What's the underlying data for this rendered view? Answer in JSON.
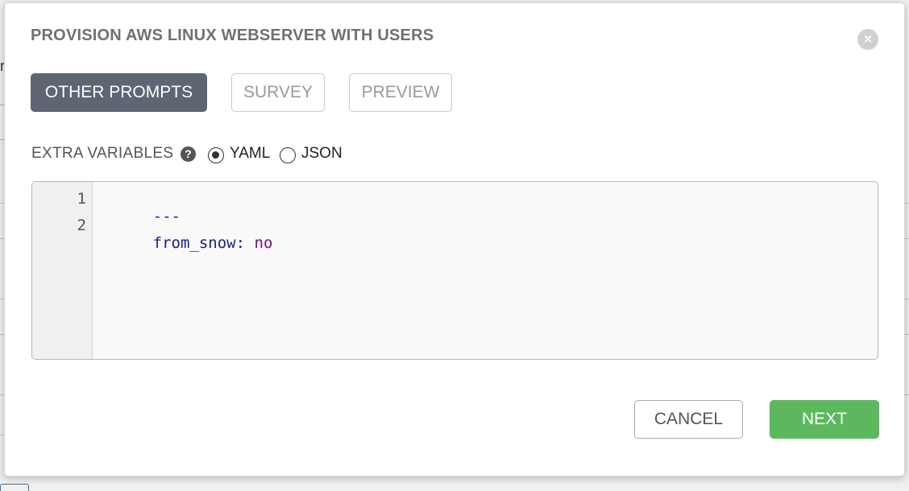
{
  "modal": {
    "title": "PROVISION AWS LINUX WEBSERVER WITH USERS",
    "close_icon": "times-circle-icon"
  },
  "tabs": [
    {
      "label": "OTHER PROMPTS",
      "active": true
    },
    {
      "label": "SURVEY",
      "active": false
    },
    {
      "label": "PREVIEW",
      "active": false
    }
  ],
  "extra_variables": {
    "label": "EXTRA VARIABLES",
    "help_icon": "question-circle-icon",
    "help_glyph": "?",
    "format_options": [
      {
        "label": "YAML",
        "selected": true
      },
      {
        "label": "JSON",
        "selected": false
      }
    ]
  },
  "editor": {
    "line_numbers": [
      "1",
      "2"
    ],
    "lines": [
      {
        "doc_marker": "---"
      },
      {
        "key": "from_snow",
        "separator": ":",
        "value": "no"
      }
    ]
  },
  "footer": {
    "cancel_label": "CANCEL",
    "next_label": "NEXT"
  },
  "colors": {
    "active_tab": "#5e6673",
    "next_button": "#5cb85c",
    "close_icon_bg": "#d0d0d0"
  }
}
